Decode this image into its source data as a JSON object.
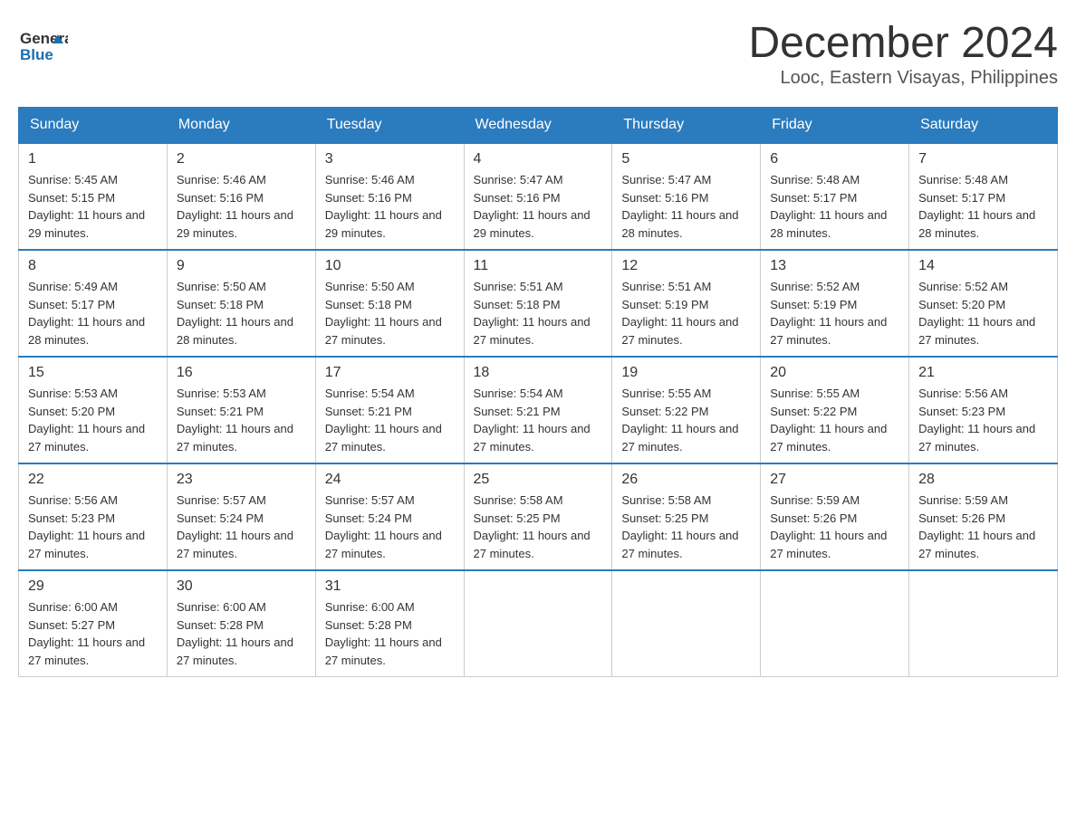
{
  "header": {
    "title": "December 2024",
    "subtitle": "Looc, Eastern Visayas, Philippines",
    "logo_general": "General",
    "logo_blue": "Blue"
  },
  "weekdays": [
    "Sunday",
    "Monday",
    "Tuesday",
    "Wednesday",
    "Thursday",
    "Friday",
    "Saturday"
  ],
  "weeks": [
    [
      {
        "day": "1",
        "sunrise": "5:45 AM",
        "sunset": "5:15 PM",
        "daylight": "11 hours and 29 minutes."
      },
      {
        "day": "2",
        "sunrise": "5:46 AM",
        "sunset": "5:16 PM",
        "daylight": "11 hours and 29 minutes."
      },
      {
        "day": "3",
        "sunrise": "5:46 AM",
        "sunset": "5:16 PM",
        "daylight": "11 hours and 29 minutes."
      },
      {
        "day": "4",
        "sunrise": "5:47 AM",
        "sunset": "5:16 PM",
        "daylight": "11 hours and 29 minutes."
      },
      {
        "day": "5",
        "sunrise": "5:47 AM",
        "sunset": "5:16 PM",
        "daylight": "11 hours and 28 minutes."
      },
      {
        "day": "6",
        "sunrise": "5:48 AM",
        "sunset": "5:17 PM",
        "daylight": "11 hours and 28 minutes."
      },
      {
        "day": "7",
        "sunrise": "5:48 AM",
        "sunset": "5:17 PM",
        "daylight": "11 hours and 28 minutes."
      }
    ],
    [
      {
        "day": "8",
        "sunrise": "5:49 AM",
        "sunset": "5:17 PM",
        "daylight": "11 hours and 28 minutes."
      },
      {
        "day": "9",
        "sunrise": "5:50 AM",
        "sunset": "5:18 PM",
        "daylight": "11 hours and 28 minutes."
      },
      {
        "day": "10",
        "sunrise": "5:50 AM",
        "sunset": "5:18 PM",
        "daylight": "11 hours and 27 minutes."
      },
      {
        "day": "11",
        "sunrise": "5:51 AM",
        "sunset": "5:18 PM",
        "daylight": "11 hours and 27 minutes."
      },
      {
        "day": "12",
        "sunrise": "5:51 AM",
        "sunset": "5:19 PM",
        "daylight": "11 hours and 27 minutes."
      },
      {
        "day": "13",
        "sunrise": "5:52 AM",
        "sunset": "5:19 PM",
        "daylight": "11 hours and 27 minutes."
      },
      {
        "day": "14",
        "sunrise": "5:52 AM",
        "sunset": "5:20 PM",
        "daylight": "11 hours and 27 minutes."
      }
    ],
    [
      {
        "day": "15",
        "sunrise": "5:53 AM",
        "sunset": "5:20 PM",
        "daylight": "11 hours and 27 minutes."
      },
      {
        "day": "16",
        "sunrise": "5:53 AM",
        "sunset": "5:21 PM",
        "daylight": "11 hours and 27 minutes."
      },
      {
        "day": "17",
        "sunrise": "5:54 AM",
        "sunset": "5:21 PM",
        "daylight": "11 hours and 27 minutes."
      },
      {
        "day": "18",
        "sunrise": "5:54 AM",
        "sunset": "5:21 PM",
        "daylight": "11 hours and 27 minutes."
      },
      {
        "day": "19",
        "sunrise": "5:55 AM",
        "sunset": "5:22 PM",
        "daylight": "11 hours and 27 minutes."
      },
      {
        "day": "20",
        "sunrise": "5:55 AM",
        "sunset": "5:22 PM",
        "daylight": "11 hours and 27 minutes."
      },
      {
        "day": "21",
        "sunrise": "5:56 AM",
        "sunset": "5:23 PM",
        "daylight": "11 hours and 27 minutes."
      }
    ],
    [
      {
        "day": "22",
        "sunrise": "5:56 AM",
        "sunset": "5:23 PM",
        "daylight": "11 hours and 27 minutes."
      },
      {
        "day": "23",
        "sunrise": "5:57 AM",
        "sunset": "5:24 PM",
        "daylight": "11 hours and 27 minutes."
      },
      {
        "day": "24",
        "sunrise": "5:57 AM",
        "sunset": "5:24 PM",
        "daylight": "11 hours and 27 minutes."
      },
      {
        "day": "25",
        "sunrise": "5:58 AM",
        "sunset": "5:25 PM",
        "daylight": "11 hours and 27 minutes."
      },
      {
        "day": "26",
        "sunrise": "5:58 AM",
        "sunset": "5:25 PM",
        "daylight": "11 hours and 27 minutes."
      },
      {
        "day": "27",
        "sunrise": "5:59 AM",
        "sunset": "5:26 PM",
        "daylight": "11 hours and 27 minutes."
      },
      {
        "day": "28",
        "sunrise": "5:59 AM",
        "sunset": "5:26 PM",
        "daylight": "11 hours and 27 minutes."
      }
    ],
    [
      {
        "day": "29",
        "sunrise": "6:00 AM",
        "sunset": "5:27 PM",
        "daylight": "11 hours and 27 minutes."
      },
      {
        "day": "30",
        "sunrise": "6:00 AM",
        "sunset": "5:28 PM",
        "daylight": "11 hours and 27 minutes."
      },
      {
        "day": "31",
        "sunrise": "6:00 AM",
        "sunset": "5:28 PM",
        "daylight": "11 hours and 27 minutes."
      },
      null,
      null,
      null,
      null
    ]
  ],
  "labels": {
    "sunrise": "Sunrise:",
    "sunset": "Sunset:",
    "daylight": "Daylight:"
  },
  "accent_color": "#2b7bbf"
}
